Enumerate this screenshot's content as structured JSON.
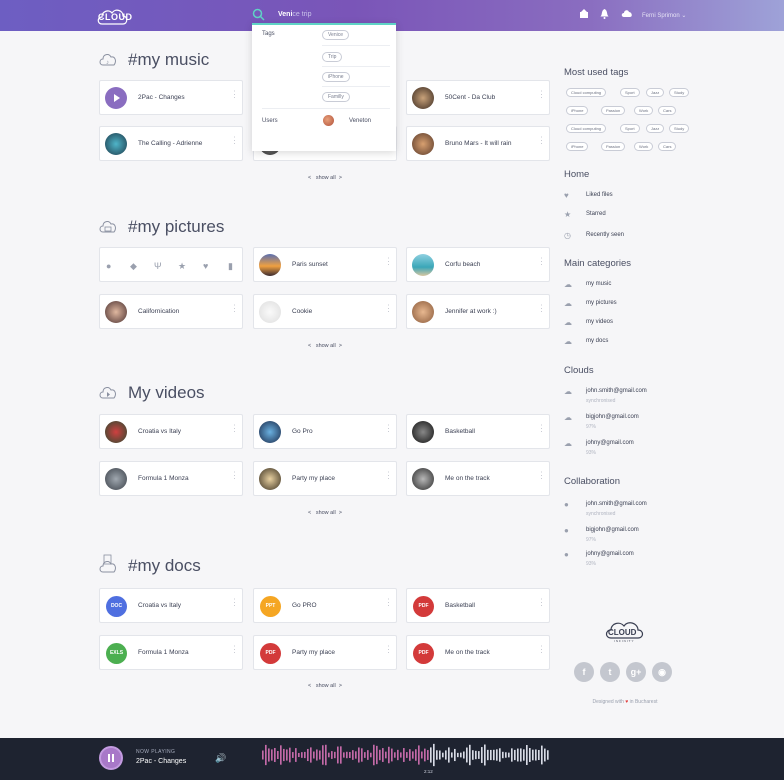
{
  "header": {
    "logo_text": "CLOUD",
    "search_typed": "Veni",
    "search_hint": "ce trip",
    "user_name": "Ferni Sprimon"
  },
  "search_dropdown": {
    "tags_label": "Tags",
    "tags": [
      "Venice",
      "Trip",
      "iPhone",
      "Familly"
    ],
    "users_label": "Users",
    "user": "Veneton"
  },
  "music": {
    "title": "#my music",
    "items": [
      "2Pac - Changes",
      "",
      "50Cent - Da Club",
      "The Calling - Adrienne",
      "",
      "Bruno Mars - It will rain"
    ],
    "show_all": "show all"
  },
  "pictures": {
    "title": "#my pictures",
    "items": [
      "Paris sunset",
      "Corfu beach",
      "Californication",
      "Cookie",
      "Jennifer at work :)"
    ],
    "show_all": "show all"
  },
  "videos": {
    "title": "My videos",
    "items": [
      "Croatia vs Italy",
      "Go Pro",
      "Basketball",
      "Formula 1 Monza",
      "Party my place",
      "Me on the track"
    ],
    "show_all": "show all"
  },
  "docs": {
    "title": "#my docs",
    "items": [
      {
        "label": "Croatia vs Italy",
        "badge": "DOC",
        "color": "#4f6fe0"
      },
      {
        "label": "Go PRO",
        "badge": "PPT",
        "color": "#f5a623"
      },
      {
        "label": "Basketball",
        "badge": "PDF",
        "color": "#d33a3a"
      },
      {
        "label": "Formula 1 Monza",
        "badge": "EXLS",
        "color": "#4caf50"
      },
      {
        "label": "Party my place",
        "badge": "PDF",
        "color": "#d33a3a"
      },
      {
        "label": "Me on the track",
        "badge": "PDF",
        "color": "#d33a3a"
      }
    ],
    "show_all": "show all"
  },
  "sidebar": {
    "tags_title": "Most used tags",
    "tag_rows": [
      [
        "Cloud computing",
        "Sport",
        "Jazz",
        "Study"
      ],
      [
        "iPhone",
        "Passion",
        "Work",
        "Cars"
      ],
      [
        "Cloud computing",
        "Sport",
        "Jazz",
        "Study"
      ],
      [
        "iPhone",
        "Passion",
        "Work",
        "Cars"
      ]
    ],
    "home_title": "Home",
    "home_items": [
      "Liked files",
      "Starred",
      "Recently seen"
    ],
    "categories_title": "Main categories",
    "categories": [
      "my music",
      "my pictures",
      "my videos",
      "my docs"
    ],
    "clouds_title": "Clouds",
    "clouds": [
      {
        "email": "john.smith@gmail.com",
        "status": "synchronised"
      },
      {
        "email": "bigjohn@gmail.com",
        "status": "97%"
      },
      {
        "email": "johny@gmail.com",
        "status": "93%"
      }
    ],
    "collab_title": "Collaboration",
    "collab": [
      {
        "email": "john.smith@gmail.com",
        "status": "synchronised"
      },
      {
        "email": "bigjohn@gmail.com",
        "status": "97%"
      },
      {
        "email": "johny@gmail.com",
        "status": "93%"
      }
    ],
    "footer_logo": "CLOUD",
    "footer_sub": "INFINITY",
    "designed_with": "Designed with",
    "designed_in": "in Bucharest"
  },
  "player": {
    "now_playing": "NOW PLAYING",
    "track": "2Pac - Changes",
    "time": "2:12",
    "progress": 0.58
  },
  "colors": {
    "accent": "#5fd3c5",
    "header_from": "#6d5ec2",
    "header_to": "#9ea2d8",
    "player_bg": "#1e2330"
  }
}
